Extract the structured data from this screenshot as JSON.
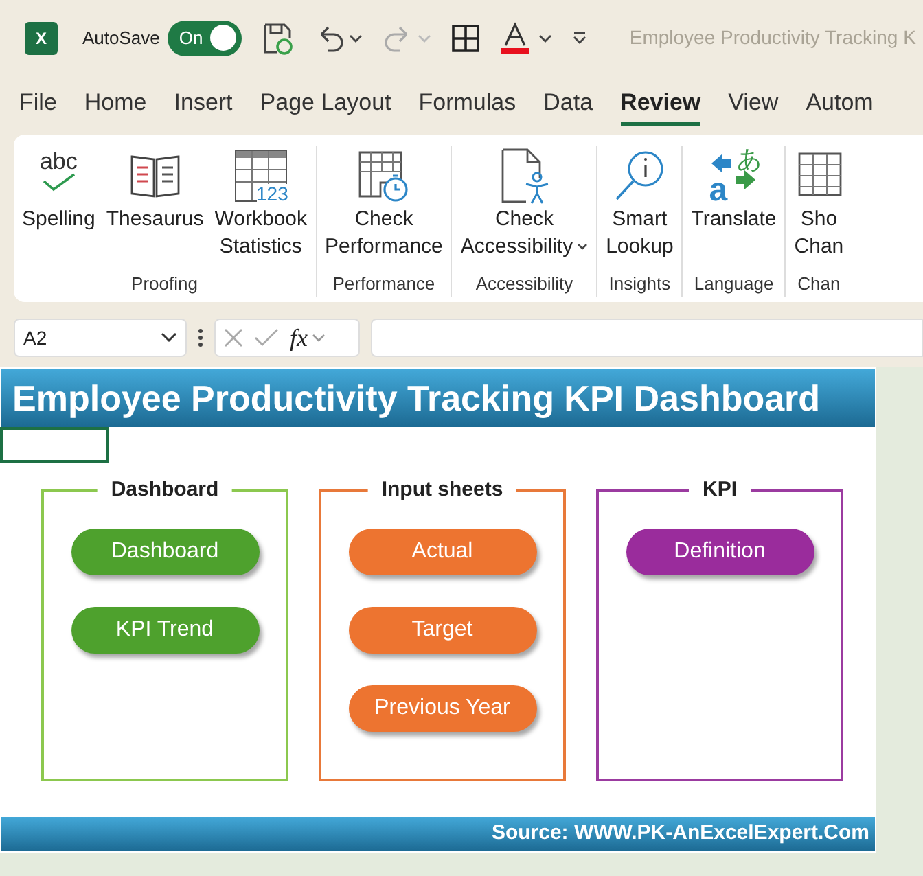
{
  "title_bar": {
    "app_logo": "X",
    "autosave_label": "AutoSave",
    "autosave_on": true,
    "autosave_state": "On",
    "document_title": "Employee Productivity Tracking K"
  },
  "menu_tabs": [
    {
      "label": "File",
      "selected": false
    },
    {
      "label": "Home",
      "selected": false
    },
    {
      "label": "Insert",
      "selected": false
    },
    {
      "label": "Page Layout",
      "selected": false
    },
    {
      "label": "Formulas",
      "selected": false
    },
    {
      "label": "Data",
      "selected": false
    },
    {
      "label": "Review",
      "selected": true
    },
    {
      "label": "View",
      "selected": false
    },
    {
      "label": "Autom",
      "selected": false
    }
  ],
  "ribbon_groups": [
    {
      "label": "Proofing",
      "buttons": [
        {
          "kind": "spelling",
          "lines": [
            "Spelling"
          ],
          "icon_text": [
            "abc"
          ]
        },
        {
          "kind": "thesaurus",
          "lines": [
            "Thesaurus"
          ]
        },
        {
          "kind": "statistics",
          "lines": [
            "Workbook",
            "Statistics"
          ],
          "icon_text": [
            "123"
          ]
        }
      ]
    },
    {
      "label": "Performance",
      "buttons": [
        {
          "kind": "performance",
          "lines": [
            "Check",
            "Performance"
          ]
        }
      ]
    },
    {
      "label": "Accessibility",
      "buttons": [
        {
          "kind": "accessibility",
          "lines": [
            "Check",
            "Accessibility"
          ],
          "dropdown": true
        }
      ]
    },
    {
      "label": "Insights",
      "buttons": [
        {
          "kind": "lookup",
          "lines": [
            "Smart",
            "Lookup"
          ]
        }
      ]
    },
    {
      "label": "Language",
      "buttons": [
        {
          "kind": "translate",
          "lines": [
            "Translate"
          ],
          "icon_text": [
            "a",
            "あ"
          ]
        }
      ]
    },
    {
      "label": "Chan",
      "buttons": [
        {
          "kind": "changes",
          "lines": [
            "Sho",
            "Chan"
          ]
        }
      ]
    }
  ],
  "formula_bar": {
    "name_box": "A2",
    "function_symbol": "fx"
  },
  "sheet": {
    "title": "Employee Productivity Tracking KPI Dashboard",
    "groups": [
      {
        "heading": "Dashboard",
        "color": "#8cc84f",
        "buttons": [
          {
            "label": "Dashboard",
            "color": "#4ea12d"
          },
          {
            "label": "KPI Trend",
            "color": "#4ea12d"
          }
        ]
      },
      {
        "heading": "Input sheets",
        "color": "#e8793a",
        "buttons": [
          {
            "label": "Actual",
            "color": "#ed7430"
          },
          {
            "label": "Target",
            "color": "#ed7430"
          },
          {
            "label": "Previous Year",
            "color": "#ed7430"
          }
        ]
      },
      {
        "heading": "KPI",
        "color": "#9b3ba0",
        "buttons": [
          {
            "label": "Definition",
            "color": "#9a2c9c"
          }
        ]
      }
    ],
    "footer": "Source: WWW.PK-AnExcelExpert.Com"
  }
}
